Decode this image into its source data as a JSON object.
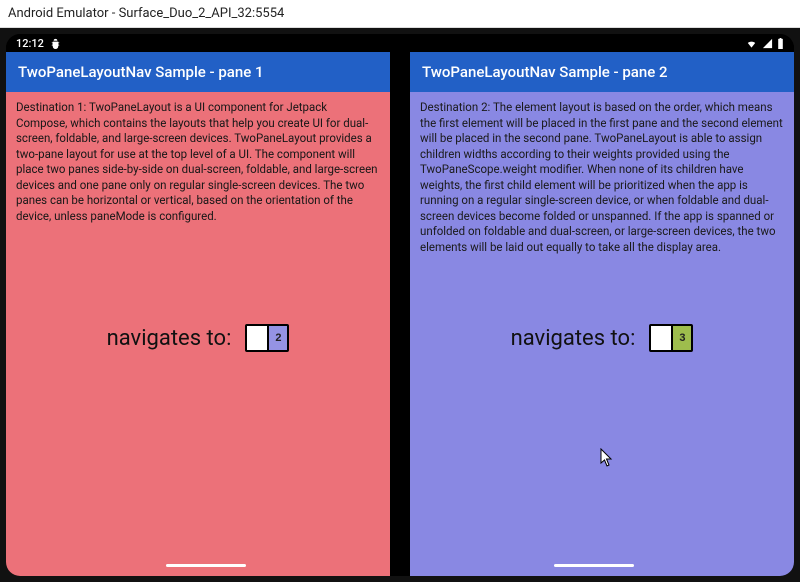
{
  "window": {
    "title": "Android Emulator - Surface_Duo_2_API_32:5554"
  },
  "statusBar": {
    "time": "12:12"
  },
  "paneLeft": {
    "appBarTitle": "TwoPaneLayoutNav Sample - pane 1",
    "description": "Destination 1: TwoPaneLayout is a UI component for Jetpack Compose, which contains the layouts that help you create UI for dual-screen, foldable, and large-screen devices. TwoPaneLayout provides a two-pane layout for use at the top level of a UI. The component will place two panes side-by-side on dual-screen, foldable, and large-screen devices and one pane only on regular single-screen devices. The two panes can be horizontal or vertical, based on the orientation of the device, unless paneMode is configured.",
    "navLabel": "navigates to:",
    "navButtons": [
      "",
      "2"
    ]
  },
  "paneRight": {
    "appBarTitle": "TwoPaneLayoutNav Sample - pane 2",
    "description": "Destination 2: The element layout is based on the order, which means the first element will be placed in the first pane and the second element will be placed in the second pane. TwoPaneLayout is able to assign children widths according to their weights provided using the TwoPaneScope.weight modifier. When none of its children have weights, the first child element will be prioritized when the app is running on a regular single-screen device, or when foldable and dual-screen devices become folded or unspanned. If the app is spanned or unfolded on foldable and dual-screen, or large-screen devices, the two elements will be laid out equally to take all the display area.",
    "navLabel": "navigates to:",
    "navButtons": [
      "",
      "3"
    ]
  }
}
